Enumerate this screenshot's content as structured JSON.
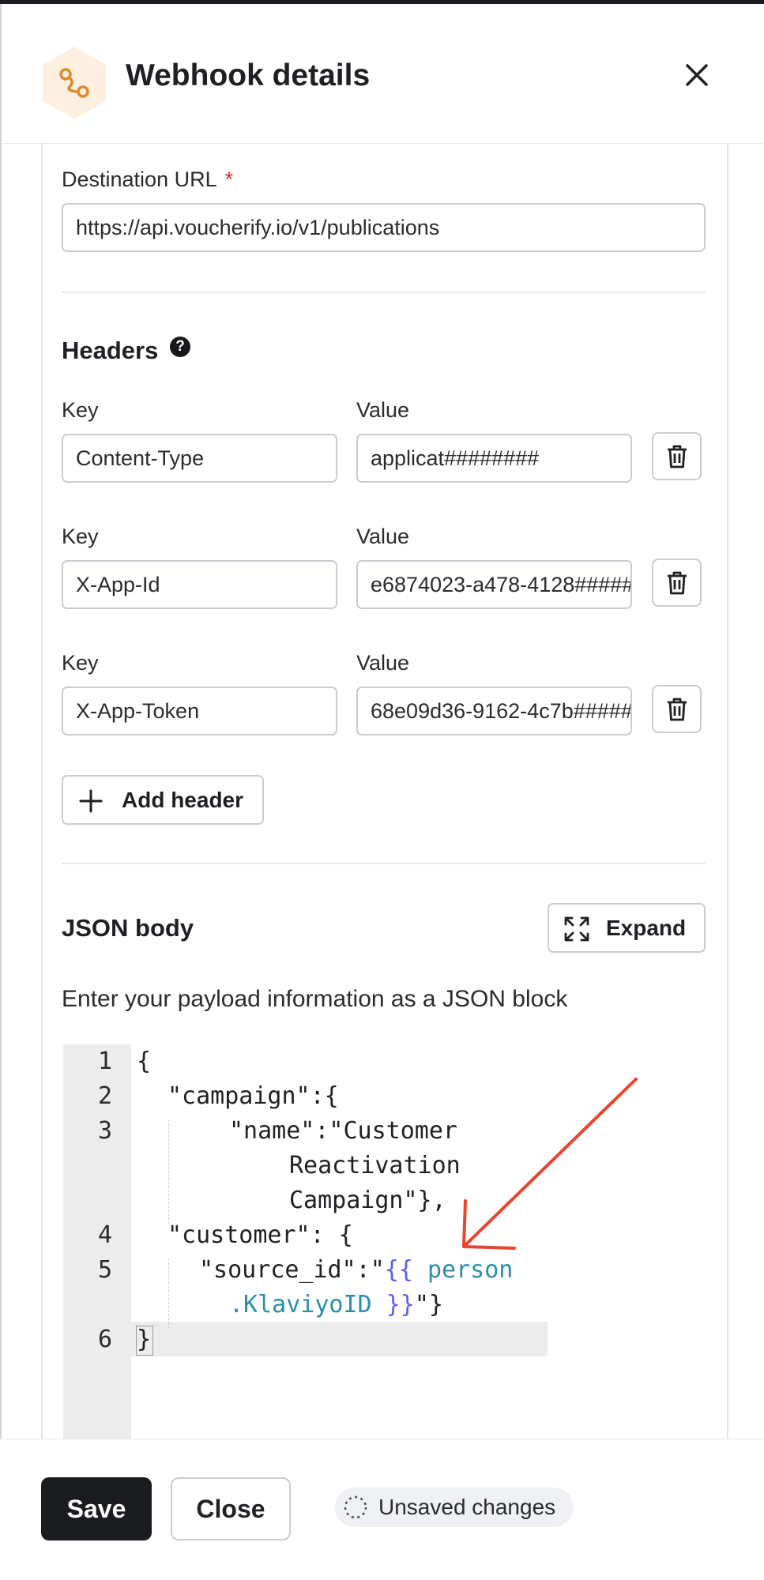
{
  "header": {
    "title": "Webhook details",
    "logo_icon": "webhook-icon",
    "close_icon": "close-icon"
  },
  "destination": {
    "label": "Destination URL",
    "required_mark": "*",
    "value": "https://api.voucherify.io/v1/publications"
  },
  "headers_section": {
    "title": "Headers",
    "help_glyph": "?",
    "add_label": "Add header",
    "rows": [
      {
        "key_label": "Key",
        "value_label": "Value",
        "key": "Content-Type",
        "value": "applicat########"
      },
      {
        "key_label": "Key",
        "value_label": "Value",
        "key": "X-App-Id",
        "value": "e6874023-a478-4128#####"
      },
      {
        "key_label": "Key",
        "value_label": "Value",
        "key": "X-App-Token",
        "value": "68e09d36-9162-4c7b#####"
      }
    ]
  },
  "json_body": {
    "title": "JSON body",
    "expand_label": "Expand",
    "description": "Enter your payload information as a JSON block",
    "line_numbers": [
      "1",
      "2",
      "3",
      "4",
      "5",
      "6"
    ],
    "code": {
      "l1": "{",
      "l2": "\"campaign\":{",
      "l3a": "\"name\":\"Customer",
      "l3b": "Reactivation",
      "l3c": "Campaign\"},",
      "l4": "\"customer\": {",
      "l5a": "\"source_id\":\"",
      "l5b": "{{",
      "l5c": " person",
      "l5d": ".KlaviyoID",
      "l5e": " }}",
      "l5f": "\"}",
      "l6": "}"
    }
  },
  "footer": {
    "save_label": "Save",
    "close_label": "Close",
    "status_label": "Unsaved changes"
  },
  "colors": {
    "accent_dark": "#1b1c1f",
    "required": "#d0312d",
    "annotation_arrow": "#e8442e",
    "template_brace": "#5b5ff0",
    "template_var": "#2c8cad",
    "logo_bg": "#fdf0e0",
    "logo_fg": "#e08a2c"
  }
}
